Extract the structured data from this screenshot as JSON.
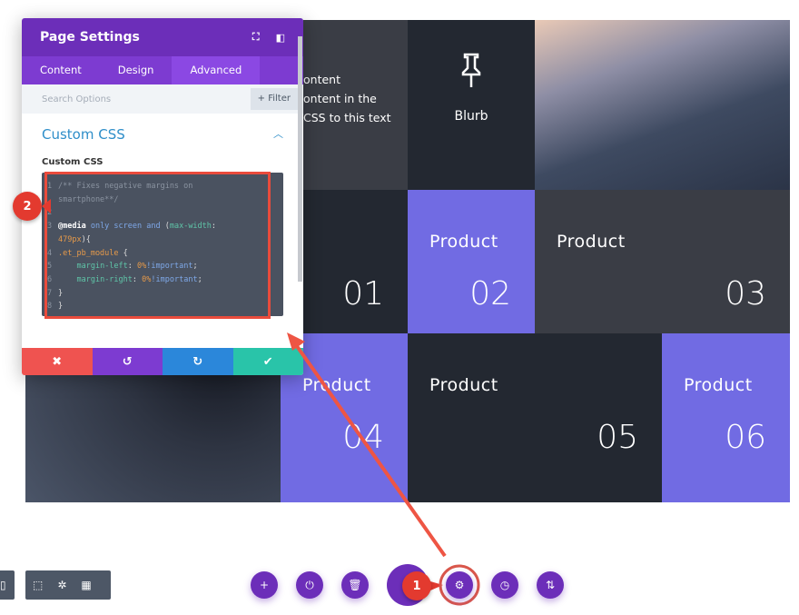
{
  "colors": {
    "purple": "#716be3",
    "dark": "#232831",
    "dark_grey": "#3a3d45",
    "panel_header": "#6c2eb9",
    "annotation_red": "#e33a2f"
  },
  "grid": {
    "text_module": {
      "lines": [
        "ontent",
        "ontent in the",
        "CSS to this text"
      ]
    },
    "blurb": {
      "icon": "pushpin-icon",
      "label": "Blurb"
    },
    "cells": [
      {
        "label": "",
        "number": "01"
      },
      {
        "label": "Product",
        "number": "02"
      },
      {
        "label": "Product",
        "number": "03"
      },
      {
        "label": "Product",
        "number": "04"
      },
      {
        "label": "Product",
        "number": "05"
      },
      {
        "label": "Product",
        "number": "06"
      }
    ]
  },
  "panel": {
    "title": "Page Settings",
    "header_icons": [
      "fullscreen-icon",
      "sidebar-icon"
    ],
    "tabs": [
      {
        "label": "Content"
      },
      {
        "label": "Design"
      },
      {
        "label": "Advanced",
        "active": true
      }
    ],
    "search_placeholder": "Search Options",
    "filter_label": "+ Filter",
    "section_title": "Custom CSS",
    "field_label": "Custom CSS",
    "code_lines": [
      {
        "n": "1",
        "tokens": [
          [
            "cm",
            "/** Fixes negative margins on"
          ]
        ]
      },
      {
        "n": "",
        "tokens": [
          [
            "cm",
            "smartphone**/"
          ]
        ]
      },
      {
        "n": "2",
        "tokens": []
      },
      {
        "n": "3",
        "tokens": [
          [
            "kw",
            "@media "
          ],
          [
            "bl",
            "only screen and "
          ],
          [
            "",
            "("
          ],
          [
            "gr",
            "max-width"
          ],
          [
            "",
            ":"
          ]
        ]
      },
      {
        "n": "",
        "tokens": [
          [
            "or",
            "479px"
          ],
          [
            "",
            "){"
          ]
        ]
      },
      {
        "n": "4",
        "tokens": [
          [
            "or",
            ".et_pb_module"
          ],
          [
            "",
            " {"
          ]
        ]
      },
      {
        "n": "5",
        "tokens": [
          [
            "",
            "    "
          ],
          [
            "gr",
            "margin-left"
          ],
          [
            "",
            ": "
          ],
          [
            "or",
            "0%"
          ],
          [
            "bl",
            "!important"
          ],
          [
            "",
            ";"
          ]
        ]
      },
      {
        "n": "6",
        "tokens": [
          [
            "",
            "    "
          ],
          [
            "gr",
            "margin-right"
          ],
          [
            "",
            ": "
          ],
          [
            "or",
            "0%"
          ],
          [
            "bl",
            "!important"
          ],
          [
            "",
            ";"
          ]
        ]
      },
      {
        "n": "7",
        "tokens": [
          [
            "",
            "}"
          ]
        ]
      },
      {
        "n": "8",
        "tokens": [
          [
            "",
            "}"
          ]
        ]
      }
    ],
    "footer": [
      {
        "icon": "close-icon",
        "glyph": "✖",
        "color": "#ef5350"
      },
      {
        "icon": "undo-icon",
        "glyph": "↺",
        "color": "#7d3bd1"
      },
      {
        "icon": "redo-icon",
        "glyph": "↻",
        "color": "#2b87da"
      },
      {
        "icon": "check-icon",
        "glyph": "✔",
        "color": "#29c4a9"
      }
    ]
  },
  "annotations": {
    "step1": "1",
    "step2": "2"
  },
  "toolbar_left": [
    {
      "icon": "phone-view-icon",
      "glyph": "▯"
    }
  ],
  "toolbar_left2": [
    {
      "icon": "select-icon",
      "glyph": "⬚"
    },
    {
      "icon": "click-mode-icon",
      "glyph": "✲"
    },
    {
      "icon": "grid-view-icon",
      "glyph": "▦"
    }
  ],
  "bottom_bar": [
    {
      "icon": "add-icon",
      "glyph": "+"
    },
    {
      "icon": "power-icon",
      "glyph": "⏻"
    },
    {
      "icon": "trash-icon",
      "glyph": "🗑"
    },
    {
      "icon": "settings-icon",
      "glyph": "⚙"
    },
    {
      "icon": "history-icon",
      "glyph": "◷"
    },
    {
      "icon": "portability-icon",
      "glyph": "⇅"
    }
  ]
}
